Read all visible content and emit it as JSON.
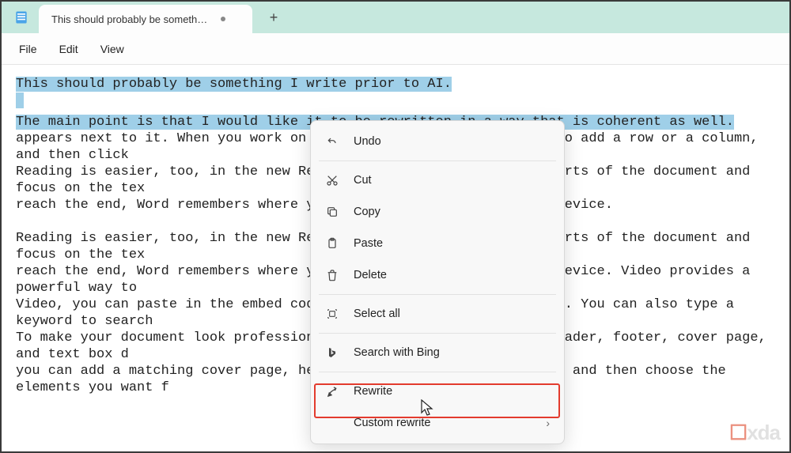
{
  "titlebar": {
    "tab_title": "This should probably be something",
    "new_tab": "+"
  },
  "menubar": {
    "file": "File",
    "edit": "Edit",
    "view": "View"
  },
  "editor": {
    "selected_line1": "This should probably be something I write prior to AI.",
    "selected_line2": "The main point is that I would like it to be rewritten in a way that is coherent as well.",
    "body_line1": "appears next to it. When you work on a table, click where you want to add a row or a column, and then click ",
    "body_line2": "Reading is easier, too, in the new Reading view. You can collapse parts of the document and focus on the tex",
    "body_line3": "reach the end, Word remembers where you left off - even on another device.",
    "body_line4": "Reading is easier, too, in the new Reading view. You can collapse parts of the document and focus on the tex",
    "body_line5": "reach the end, Word remembers where you left off - even on another device. Video provides a powerful way to ",
    "body_line6": "Video, you can paste in the embed code for the video you want to add. You can also type a keyword to search ",
    "body_line7": "To make your document look professionally produced, Word provides header, footer, cover page, and text box d",
    "body_line8": "you can add a matching cover page, header, and sidebar. Click Insert and then choose the elements you want f"
  },
  "context_menu": {
    "undo": "Undo",
    "cut": "Cut",
    "copy": "Copy",
    "paste": "Paste",
    "delete": "Delete",
    "select_all": "Select all",
    "search_bing": "Search with Bing",
    "rewrite": "Rewrite",
    "custom_rewrite": "Custom rewrite"
  },
  "watermark": {
    "text": "xda"
  }
}
